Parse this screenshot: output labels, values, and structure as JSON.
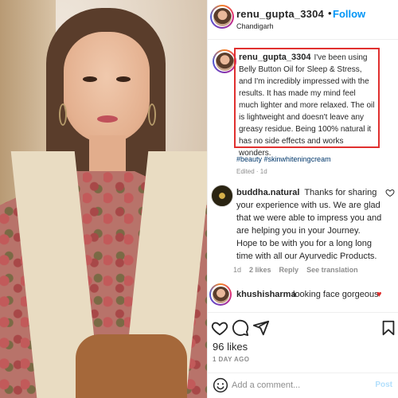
{
  "post": {
    "username": "renu_gupta_3304",
    "dot": "•",
    "follow_label": "Follow",
    "location": "Chandigarh",
    "more_icon": "more-horizontal-icon"
  },
  "caption": {
    "username": "renu_gupta_3304",
    "text": "I've been using Belly Button Oil for Sleep & Stress, and I'm incredibly impressed with the results. It has made my mind feel much lighter and more relaxed.  The oil is lightweight and doesn't leave any greasy residue. Being 100% natural it has no side effects and works wonders.",
    "hashtags": "#beauty #skinwhiteningcream",
    "edited": "Edited · 1d"
  },
  "comments": [
    {
      "username": "buddha.natural",
      "text": "Thanks for sharing your experience with us. We are glad that we were able to impress you and are helping you in your Journey. Hope to be with you for a long long time with all our Ayurvedic Products.",
      "meta_time": "1d",
      "meta_likes": "2 likes",
      "meta_reply": "Reply",
      "meta_translate": "See translation"
    },
    {
      "username": "khushisharma",
      "text": "looking face gorgeous",
      "emoji": "♥"
    }
  ],
  "stats": {
    "likes": "96 likes",
    "time_ago": "1 DAY AGO"
  },
  "add_comment": {
    "placeholder": "Add a comment...",
    "post_label": "Post"
  },
  "colors": {
    "accent_blue": "#0095f6",
    "highlight_red": "#e0302f",
    "text": "#262626",
    "muted": "#8e8e8e"
  }
}
